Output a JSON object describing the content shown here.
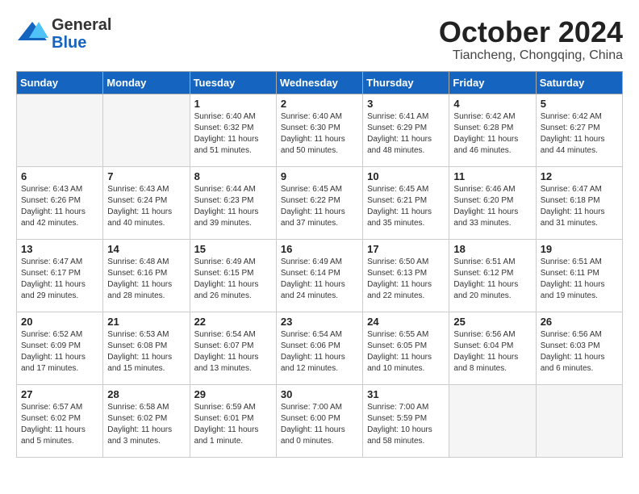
{
  "header": {
    "logo_general": "General",
    "logo_blue": "Blue",
    "month": "October 2024",
    "location": "Tiancheng, Chongqing, China"
  },
  "days_of_week": [
    "Sunday",
    "Monday",
    "Tuesday",
    "Wednesday",
    "Thursday",
    "Friday",
    "Saturday"
  ],
  "weeks": [
    [
      {
        "day": "",
        "sunrise": "",
        "sunset": "",
        "daylight": ""
      },
      {
        "day": "",
        "sunrise": "",
        "sunset": "",
        "daylight": ""
      },
      {
        "day": "1",
        "sunrise": "Sunrise: 6:40 AM",
        "sunset": "Sunset: 6:32 PM",
        "daylight": "Daylight: 11 hours and 51 minutes."
      },
      {
        "day": "2",
        "sunrise": "Sunrise: 6:40 AM",
        "sunset": "Sunset: 6:30 PM",
        "daylight": "Daylight: 11 hours and 50 minutes."
      },
      {
        "day": "3",
        "sunrise": "Sunrise: 6:41 AM",
        "sunset": "Sunset: 6:29 PM",
        "daylight": "Daylight: 11 hours and 48 minutes."
      },
      {
        "day": "4",
        "sunrise": "Sunrise: 6:42 AM",
        "sunset": "Sunset: 6:28 PM",
        "daylight": "Daylight: 11 hours and 46 minutes."
      },
      {
        "day": "5",
        "sunrise": "Sunrise: 6:42 AM",
        "sunset": "Sunset: 6:27 PM",
        "daylight": "Daylight: 11 hours and 44 minutes."
      }
    ],
    [
      {
        "day": "6",
        "sunrise": "Sunrise: 6:43 AM",
        "sunset": "Sunset: 6:26 PM",
        "daylight": "Daylight: 11 hours and 42 minutes."
      },
      {
        "day": "7",
        "sunrise": "Sunrise: 6:43 AM",
        "sunset": "Sunset: 6:24 PM",
        "daylight": "Daylight: 11 hours and 40 minutes."
      },
      {
        "day": "8",
        "sunrise": "Sunrise: 6:44 AM",
        "sunset": "Sunset: 6:23 PM",
        "daylight": "Daylight: 11 hours and 39 minutes."
      },
      {
        "day": "9",
        "sunrise": "Sunrise: 6:45 AM",
        "sunset": "Sunset: 6:22 PM",
        "daylight": "Daylight: 11 hours and 37 minutes."
      },
      {
        "day": "10",
        "sunrise": "Sunrise: 6:45 AM",
        "sunset": "Sunset: 6:21 PM",
        "daylight": "Daylight: 11 hours and 35 minutes."
      },
      {
        "day": "11",
        "sunrise": "Sunrise: 6:46 AM",
        "sunset": "Sunset: 6:20 PM",
        "daylight": "Daylight: 11 hours and 33 minutes."
      },
      {
        "day": "12",
        "sunrise": "Sunrise: 6:47 AM",
        "sunset": "Sunset: 6:18 PM",
        "daylight": "Daylight: 11 hours and 31 minutes."
      }
    ],
    [
      {
        "day": "13",
        "sunrise": "Sunrise: 6:47 AM",
        "sunset": "Sunset: 6:17 PM",
        "daylight": "Daylight: 11 hours and 29 minutes."
      },
      {
        "day": "14",
        "sunrise": "Sunrise: 6:48 AM",
        "sunset": "Sunset: 6:16 PM",
        "daylight": "Daylight: 11 hours and 28 minutes."
      },
      {
        "day": "15",
        "sunrise": "Sunrise: 6:49 AM",
        "sunset": "Sunset: 6:15 PM",
        "daylight": "Daylight: 11 hours and 26 minutes."
      },
      {
        "day": "16",
        "sunrise": "Sunrise: 6:49 AM",
        "sunset": "Sunset: 6:14 PM",
        "daylight": "Daylight: 11 hours and 24 minutes."
      },
      {
        "day": "17",
        "sunrise": "Sunrise: 6:50 AM",
        "sunset": "Sunset: 6:13 PM",
        "daylight": "Daylight: 11 hours and 22 minutes."
      },
      {
        "day": "18",
        "sunrise": "Sunrise: 6:51 AM",
        "sunset": "Sunset: 6:12 PM",
        "daylight": "Daylight: 11 hours and 20 minutes."
      },
      {
        "day": "19",
        "sunrise": "Sunrise: 6:51 AM",
        "sunset": "Sunset: 6:11 PM",
        "daylight": "Daylight: 11 hours and 19 minutes."
      }
    ],
    [
      {
        "day": "20",
        "sunrise": "Sunrise: 6:52 AM",
        "sunset": "Sunset: 6:09 PM",
        "daylight": "Daylight: 11 hours and 17 minutes."
      },
      {
        "day": "21",
        "sunrise": "Sunrise: 6:53 AM",
        "sunset": "Sunset: 6:08 PM",
        "daylight": "Daylight: 11 hours and 15 minutes."
      },
      {
        "day": "22",
        "sunrise": "Sunrise: 6:54 AM",
        "sunset": "Sunset: 6:07 PM",
        "daylight": "Daylight: 11 hours and 13 minutes."
      },
      {
        "day": "23",
        "sunrise": "Sunrise: 6:54 AM",
        "sunset": "Sunset: 6:06 PM",
        "daylight": "Daylight: 11 hours and 12 minutes."
      },
      {
        "day": "24",
        "sunrise": "Sunrise: 6:55 AM",
        "sunset": "Sunset: 6:05 PM",
        "daylight": "Daylight: 11 hours and 10 minutes."
      },
      {
        "day": "25",
        "sunrise": "Sunrise: 6:56 AM",
        "sunset": "Sunset: 6:04 PM",
        "daylight": "Daylight: 11 hours and 8 minutes."
      },
      {
        "day": "26",
        "sunrise": "Sunrise: 6:56 AM",
        "sunset": "Sunset: 6:03 PM",
        "daylight": "Daylight: 11 hours and 6 minutes."
      }
    ],
    [
      {
        "day": "27",
        "sunrise": "Sunrise: 6:57 AM",
        "sunset": "Sunset: 6:02 PM",
        "daylight": "Daylight: 11 hours and 5 minutes."
      },
      {
        "day": "28",
        "sunrise": "Sunrise: 6:58 AM",
        "sunset": "Sunset: 6:02 PM",
        "daylight": "Daylight: 11 hours and 3 minutes."
      },
      {
        "day": "29",
        "sunrise": "Sunrise: 6:59 AM",
        "sunset": "Sunset: 6:01 PM",
        "daylight": "Daylight: 11 hours and 1 minute."
      },
      {
        "day": "30",
        "sunrise": "Sunrise: 7:00 AM",
        "sunset": "Sunset: 6:00 PM",
        "daylight": "Daylight: 11 hours and 0 minutes."
      },
      {
        "day": "31",
        "sunrise": "Sunrise: 7:00 AM",
        "sunset": "Sunset: 5:59 PM",
        "daylight": "Daylight: 10 hours and 58 minutes."
      },
      {
        "day": "",
        "sunrise": "",
        "sunset": "",
        "daylight": ""
      },
      {
        "day": "",
        "sunrise": "",
        "sunset": "",
        "daylight": ""
      }
    ]
  ]
}
